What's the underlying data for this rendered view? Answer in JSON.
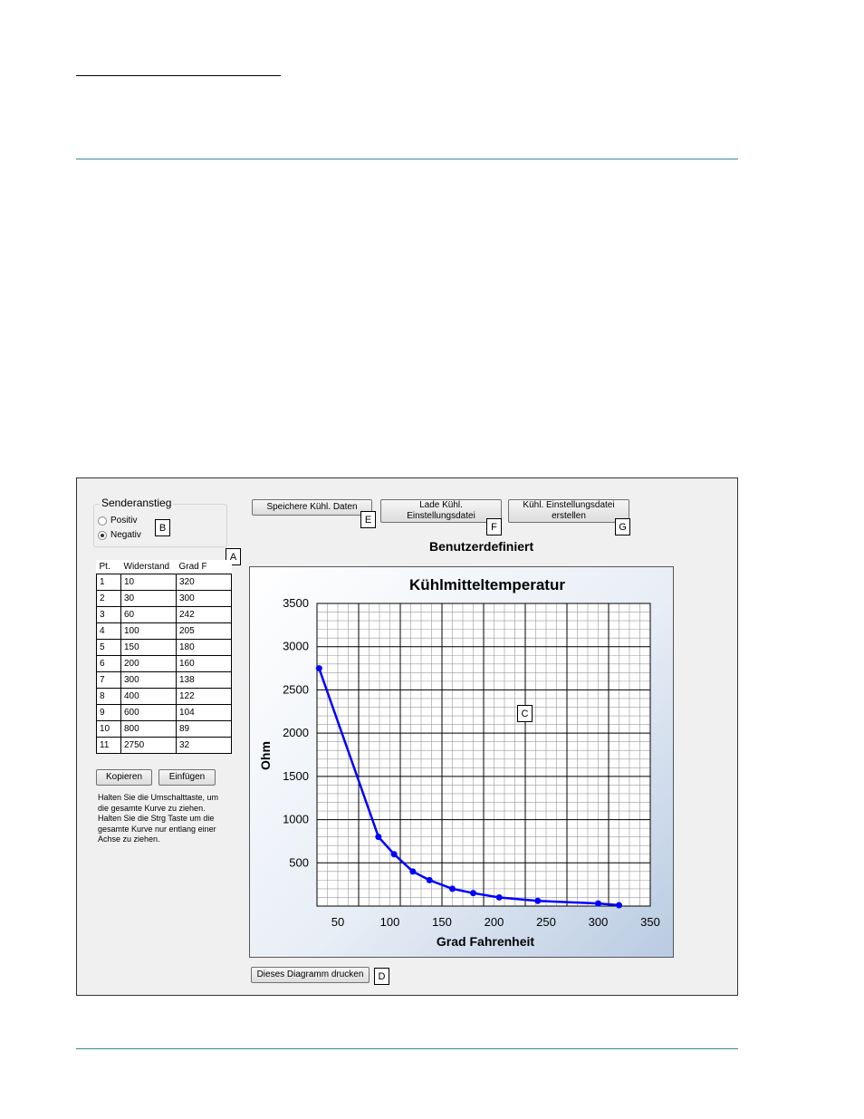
{
  "window": {
    "group_title": "Senderanstieg",
    "radio_options": [
      {
        "label": "Positiv",
        "selected": false
      },
      {
        "label": "Negativ",
        "selected": true
      }
    ],
    "buttons": {
      "save": "Speichere Kühl. Daten",
      "load": "Lade Kühl. Einstellungsdatei",
      "create_line1": "Kühl. Einstellungsdatei",
      "create_line2": "erstellen",
      "copy": "Kopieren",
      "paste": "Einfügen",
      "print": "Dieses Diagramm drucken"
    },
    "subtitle": "Benutzerdefiniert",
    "callouts": {
      "a": "A",
      "b": "B",
      "c": "C",
      "d": "D",
      "e": "E",
      "f": "F",
      "g": "G"
    },
    "table": {
      "headers": [
        "Pt.",
        "Widerstand",
        "Grad F"
      ],
      "rows": [
        [
          "1",
          "10",
          "320"
        ],
        [
          "2",
          "30",
          "300"
        ],
        [
          "3",
          "60",
          "242"
        ],
        [
          "4",
          "100",
          "205"
        ],
        [
          "5",
          "150",
          "180"
        ],
        [
          "6",
          "200",
          "160"
        ],
        [
          "7",
          "300",
          "138"
        ],
        [
          "8",
          "400",
          "122"
        ],
        [
          "9",
          "600",
          "104"
        ],
        [
          "10",
          "800",
          "89"
        ],
        [
          "11",
          "2750",
          "32"
        ]
      ]
    },
    "hint": "Halten Sie die Umschalttaste, um die gesamte Kurve zu ziehen.  Halten Sie die Strg Taste um die gesamte Kurve nur entlang einer Achse zu ziehen."
  },
  "chart_data": {
    "type": "line",
    "title": "Kühlmitteltemperatur",
    "xlabel": "Grad Fahrenheit",
    "ylabel": "Ohm",
    "xlim": [
      30,
      350
    ],
    "ylim": [
      0,
      3500
    ],
    "xticks": [
      50,
      100,
      150,
      200,
      250,
      300,
      350
    ],
    "yticks": [
      500,
      1000,
      1500,
      2000,
      2500,
      3000,
      3500
    ],
    "grid": true,
    "series": [
      {
        "color": "#0000ff",
        "x": [
          32,
          89,
          104,
          122,
          138,
          160,
          180,
          205,
          242,
          300,
          320
        ],
        "y": [
          2750,
          800,
          600,
          400,
          300,
          200,
          150,
          100,
          60,
          30,
          10
        ]
      }
    ]
  }
}
